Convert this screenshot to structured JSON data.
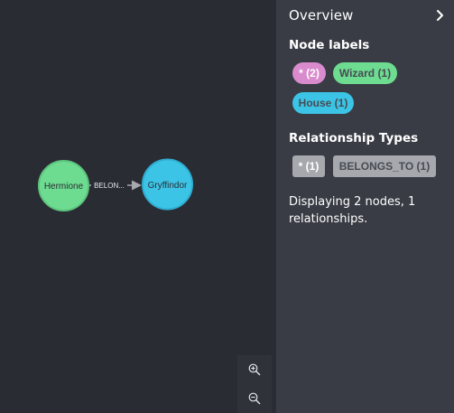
{
  "graph": {
    "nodes": [
      {
        "label": "Hermione",
        "color": "#6ddb90",
        "border": "#5cc47d"
      },
      {
        "label": "Gryffindor",
        "color": "#3cc4e6",
        "border": "#2eaed0"
      }
    ],
    "relationship": {
      "label": "BELON...",
      "color": "#a6a8ad"
    }
  },
  "zoom": {
    "zoom_in_icon": "zoom-in-icon",
    "zoom_out_icon": "zoom-out-icon"
  },
  "sidebar": {
    "title": "Overview",
    "collapse_icon": "chevron-right-icon",
    "node_labels_heading": "Node labels",
    "node_labels": [
      {
        "text": "* (2)",
        "color": "#d98bcd",
        "text_color": "#ffffff"
      },
      {
        "text": "Wizard (1)",
        "color": "#6ddb90",
        "text_color": "#474b53"
      },
      {
        "text": "House (1)",
        "color": "#3cc4e6",
        "text_color": "#474b53"
      }
    ],
    "rel_types_heading": "Relationship Types",
    "rel_types": [
      {
        "text": "* (1)",
        "color": "#a6a8ad",
        "text_color": "#ffffff"
      },
      {
        "text": "BELONGS_TO (1)",
        "color": "#a6a8ad",
        "text_color": "#474b53"
      }
    ],
    "summary": "Displaying 2 nodes, 1 relationships."
  }
}
